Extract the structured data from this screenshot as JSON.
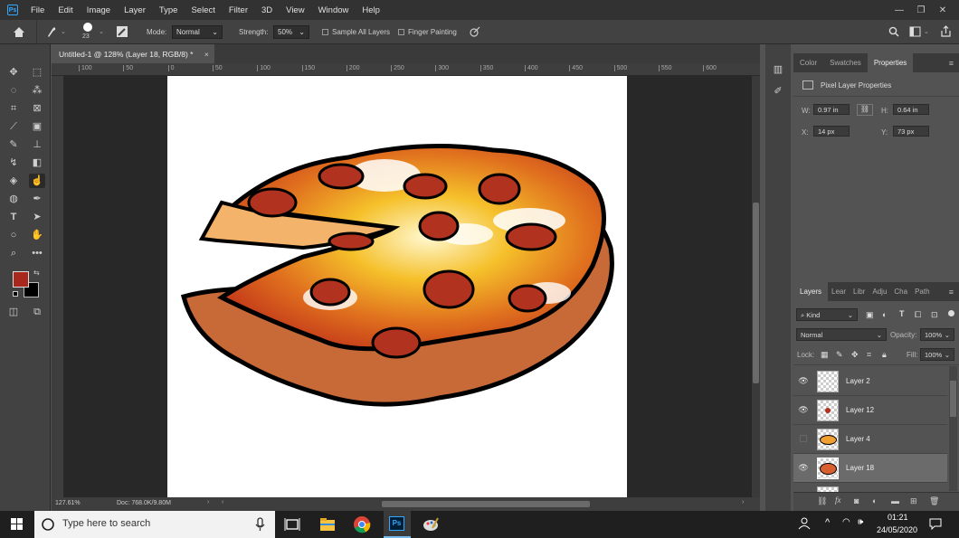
{
  "menubar": {
    "logo": "Ps",
    "items": [
      "File",
      "Edit",
      "Image",
      "Layer",
      "Type",
      "Select",
      "Filter",
      "3D",
      "View",
      "Window",
      "Help"
    ],
    "window_controls": [
      "—",
      "❐",
      "✕"
    ]
  },
  "options": {
    "brush_size": "23",
    "mode_label": "Mode:",
    "mode_value": "Normal",
    "strength_label": "Strength:",
    "strength_value": "50%",
    "sample_all_layers": "Sample All Layers",
    "finger_painting": "Finger Painting"
  },
  "document": {
    "tab_title": "Untitled-1 @ 128% (Layer 18, RGB/8) *",
    "close": "×",
    "ruler_ticks": [
      "100",
      "50",
      "0",
      "50",
      "100",
      "150",
      "200",
      "250",
      "300",
      "350",
      "400",
      "450",
      "500",
      "550",
      "600"
    ],
    "zoom": "127.61%",
    "doc_size": "Doc: 768.0K/9.80M"
  },
  "colors": {
    "foreground": "#a8281d",
    "background": "#000000"
  },
  "properties_panel": {
    "tabs": [
      "Color",
      "Swatches",
      "Properties"
    ],
    "active_tab": "Properties",
    "header": "Pixel Layer Properties",
    "w_label": "W:",
    "w_value": "0.97 in",
    "h_label": "H:",
    "h_value": "0.64 in",
    "x_label": "X:",
    "x_value": "14 px",
    "y_label": "Y:",
    "y_value": "73 px"
  },
  "layers_panel": {
    "tabs": [
      "Layers",
      "Lear",
      "Libr",
      "Adju",
      "Cha",
      "Path"
    ],
    "kind": "Kind",
    "blend_mode": "Normal",
    "opacity_label": "Opacity:",
    "opacity_value": "100%",
    "lock_label": "Lock:",
    "fill_label": "Fill:",
    "fill_value": "100%",
    "layers": [
      {
        "name": "Layer 2",
        "visible": true,
        "selected": false
      },
      {
        "name": "Layer 12",
        "visible": true,
        "selected": false
      },
      {
        "name": "Layer 4",
        "visible": false,
        "selected": false
      },
      {
        "name": "Layer 18",
        "visible": true,
        "selected": true
      }
    ]
  },
  "taskbar": {
    "search_placeholder": "Type here to search",
    "time": "01:21",
    "date": "24/05/2020"
  }
}
